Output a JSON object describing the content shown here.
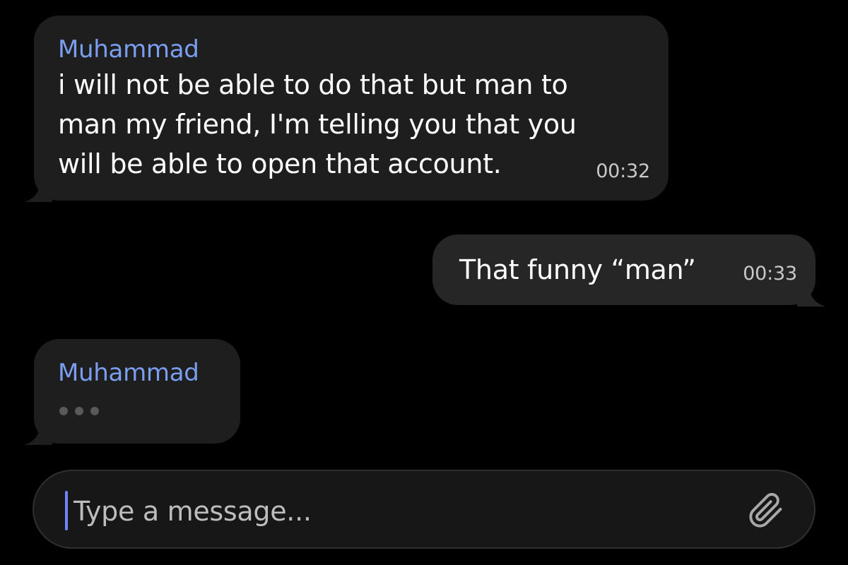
{
  "colors": {
    "background": "#000000",
    "incoming_bubble": "#1e1e1e",
    "outgoing_bubble": "#262626",
    "sender_name": "#7b9ef0",
    "caret": "#6f84ff"
  },
  "messages": [
    {
      "direction": "incoming",
      "sender": "Muhammad",
      "text": "i will not be able to do that but man to man my friend, I'm telling you that you will be able to open that account.",
      "time": "00:32"
    },
    {
      "direction": "outgoing",
      "text": "That funny “man”",
      "time": "00:33"
    },
    {
      "direction": "incoming",
      "sender": "Muhammad",
      "typing_indicator": "typing-dots"
    }
  ],
  "composer": {
    "placeholder": "Type a message...",
    "value": "",
    "attach_icon": "paperclip-icon"
  }
}
